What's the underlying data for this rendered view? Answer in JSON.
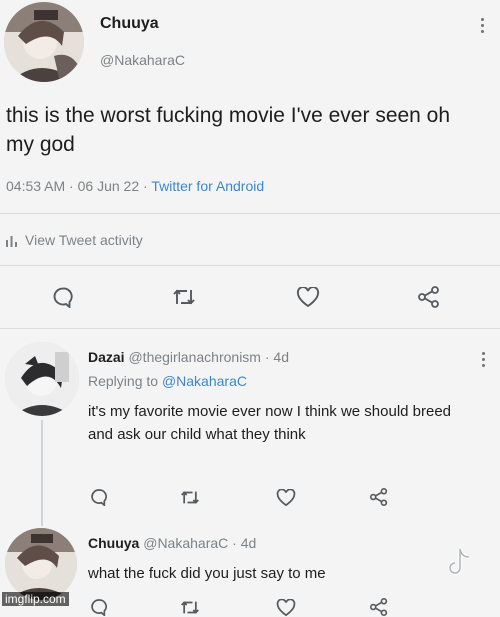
{
  "main_tweet": {
    "display_name": "Chuuya",
    "handle": "@NakaharaC",
    "text": "this is the worst fucking movie I've ever seen oh my god",
    "time": "04:53 AM",
    "date": "06 Jun 22",
    "source": "Twitter for Android",
    "activity_label": "View Tweet activity"
  },
  "reply_1": {
    "display_name": "Dazai",
    "handle": "@thegirlanachronism",
    "age": "4d",
    "replying_prefix": "Replying to",
    "replying_handle": "@NakaharaC",
    "text": "it's my favorite movie ever now I think we should breed and ask our child what they think"
  },
  "reply_2": {
    "display_name": "Chuuya",
    "handle": "@NakaharaC",
    "age": "4d",
    "text": "what the fuck did you just say to me"
  },
  "watermark": {
    "imgflip": "imgflip.com",
    "tiktok_icon": "tiktok-logo-icon"
  },
  "colors": {
    "background": "#f4f4f4",
    "link": "#3f86c8",
    "muted": "#7d8287",
    "text": "#1e1e1e"
  },
  "icons": {
    "reply": "reply-icon",
    "retweet": "retweet-icon",
    "like": "like-icon",
    "share": "share-icon",
    "more": "more-icon",
    "activity": "bar-chart-icon"
  }
}
